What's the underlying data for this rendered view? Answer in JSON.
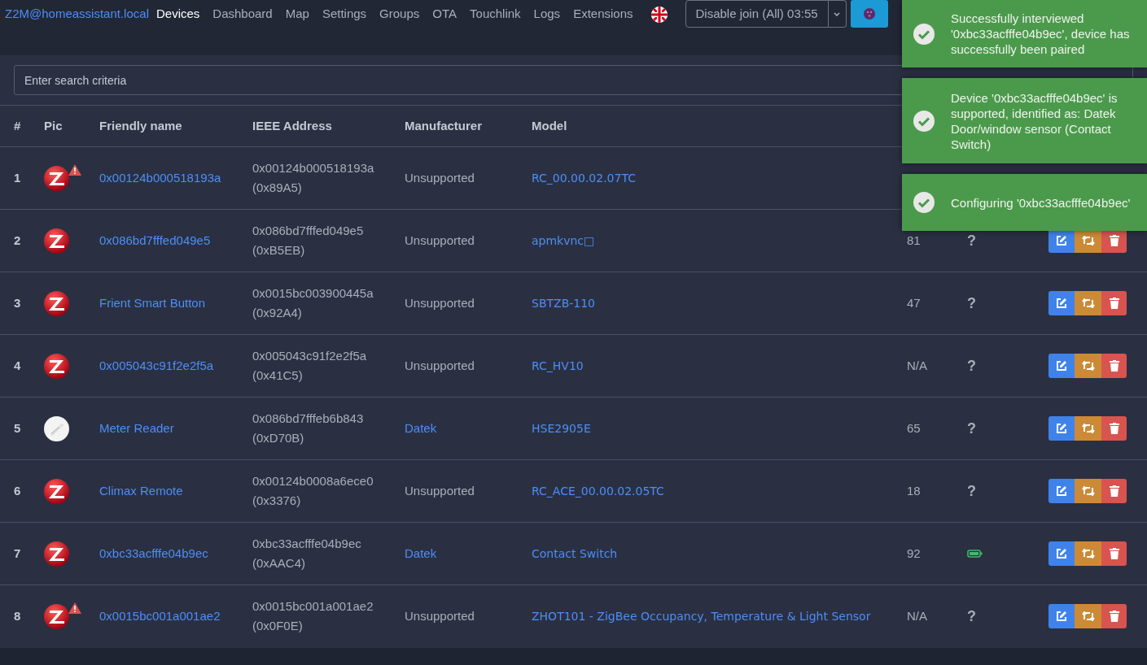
{
  "navbar": {
    "brand": "Z2M@homeassistant.local",
    "links": [
      {
        "label": "Devices",
        "selected": true
      },
      {
        "label": "Dashboard",
        "selected": false
      },
      {
        "label": "Map",
        "selected": false
      },
      {
        "label": "Settings",
        "selected": false
      },
      {
        "label": "Groups",
        "selected": false
      },
      {
        "label": "OTA",
        "selected": false
      },
      {
        "label": "Touchlink",
        "selected": false
      },
      {
        "label": "Logs",
        "selected": false
      },
      {
        "label": "Extensions",
        "selected": false
      }
    ],
    "join_button": "Disable join (All) 03:55"
  },
  "search": {
    "placeholder": "Enter search criteria"
  },
  "table": {
    "columns": [
      "#",
      "Pic",
      "Friendly name",
      "IEEE Address",
      "Manufacturer",
      "Model"
    ],
    "rows": [
      {
        "index": "1",
        "pic": {
          "kind": "zigbee"
        },
        "warning": true,
        "name": "0x00124b000518193a",
        "ieee": "0x00124b000518193a",
        "nwk": "(0x89A5)",
        "manufacturer": "Unsupported",
        "manufacturer_link": false,
        "model": "RC_00.00.02.07TC"
      },
      {
        "index": "2",
        "pic": {
          "kind": "zigbee"
        },
        "warning": false,
        "name": "0x086bd7fffed049e5",
        "ieee": "0x086bd7fffed049e5",
        "nwk": "(0xB5EB)",
        "manufacturer": "Unsupported",
        "manufacturer_link": false,
        "model": "apmkvnc□",
        "lqi": "81",
        "power": {
          "kind": "unknown",
          "text": "?"
        }
      },
      {
        "index": "3",
        "pic": {
          "kind": "zigbee"
        },
        "warning": false,
        "name": "Frient Smart Button",
        "ieee": "0x0015bc003900445a",
        "nwk": "(0x92A4)",
        "manufacturer": "Unsupported",
        "manufacturer_link": false,
        "model": "SBTZB-110",
        "lqi": "47",
        "power": {
          "kind": "unknown",
          "text": "?"
        }
      },
      {
        "index": "4",
        "pic": {
          "kind": "zigbee"
        },
        "warning": false,
        "name": "0x005043c91f2e2f5a",
        "ieee": "0x005043c91f2e2f5a",
        "nwk": "(0x41C5)",
        "manufacturer": "Unsupported",
        "manufacturer_link": false,
        "model": "RC_HV10",
        "lqi": "N/A",
        "power": {
          "kind": "unknown",
          "text": "?"
        }
      },
      {
        "index": "5",
        "warning": false,
        "name": "Meter Reader",
        "ieee": "0x086bd7fffeb6b843",
        "nwk": "(0xD70B)",
        "manufacturer": "Datek",
        "manufacturer_link": true,
        "model": "HSE2905E",
        "lqi": "65",
        "power": {
          "kind": "unknown",
          "text": "?"
        }
      },
      {
        "index": "6",
        "pic": {
          "kind": "zigbee"
        },
        "warning": false,
        "name": "Climax Remote",
        "ieee": "0x00124b0008a6ece0",
        "nwk": "(0x3376)",
        "manufacturer": "Unsupported",
        "manufacturer_link": false,
        "model": "RC_ACE_00.00.02.05TC",
        "lqi": "18",
        "power": {
          "kind": "unknown",
          "text": "?"
        }
      },
      {
        "index": "7",
        "pic": {
          "kind": "zigbee"
        },
        "warning": false,
        "name": "0xbc33acfffe04b9ec",
        "ieee": "0xbc33acfffe04b9ec",
        "nwk": "(0xAAC4)",
        "manufacturer": "Datek",
        "manufacturer_link": true,
        "model": "Contact Switch",
        "lqi": "92",
        "power": {
          "kind": "battery"
        }
      },
      {
        "index": "8",
        "pic": {
          "kind": "zigbee"
        },
        "warning": true,
        "name": "0x0015bc001a001ae2",
        "ieee": "0x0015bc001a001ae2",
        "nwk": "(0x0F0E)",
        "manufacturer": "Unsupported",
        "manufacturer_link": false,
        "model": "ZHOT101 - ZigBee Occupancy, Temperature & Light Sensor",
        "lqi": "N/A",
        "power": {
          "kind": "unknown",
          "text": "?"
        }
      }
    ]
  },
  "toasts": [
    {
      "message": "Successfully interviewed '0xbc33acfffe04b9ec', device has successfully been paired"
    },
    {
      "message": "Device '0xbc33acfffe04b9ec' is supported, identified as: Datek Door/window sensor (Contact Switch)"
    },
    {
      "message": "Configuring '0xbc33acfffe04b9ec'"
    }
  ]
}
